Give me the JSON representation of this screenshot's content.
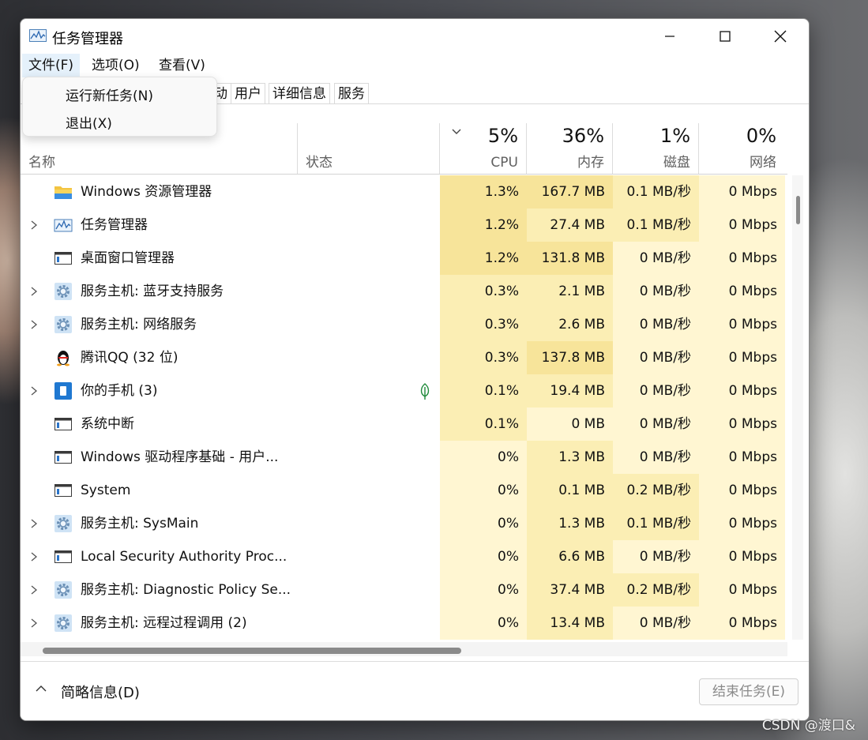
{
  "window": {
    "title": "任务管理器"
  },
  "menu": [
    {
      "label": "文件(F)"
    },
    {
      "label": "选项(O)"
    },
    {
      "label": "查看(V)"
    }
  ],
  "dropdown": [
    {
      "label": "运行新任务(N)"
    },
    {
      "label": "退出(X)"
    }
  ],
  "tabs": [
    {
      "label": "动"
    },
    {
      "label": "用户"
    },
    {
      "label": "详细信息"
    },
    {
      "label": "服务"
    }
  ],
  "columns": {
    "name": "名称",
    "status": "状态",
    "cpu": {
      "pct": "5%",
      "label": "CPU"
    },
    "mem": {
      "pct": "36%",
      "label": "内存"
    },
    "disk": {
      "pct": "1%",
      "label": "磁盘"
    },
    "net": {
      "pct": "0%",
      "label": "网络"
    }
  },
  "processes": [
    {
      "name": "Windows 资源管理器",
      "icon": "folder-icon",
      "expandable": false,
      "eco": false,
      "cpu": "1.3%",
      "mem": "167.7 MB",
      "disk": "0.1 MB/秒",
      "net": "0 Mbps"
    },
    {
      "name": "任务管理器",
      "icon": "task-manager-icon",
      "expandable": true,
      "eco": false,
      "cpu": "1.2%",
      "mem": "27.4 MB",
      "disk": "0.1 MB/秒",
      "net": "0 Mbps"
    },
    {
      "name": "桌面窗口管理器",
      "icon": "window-app-icon",
      "expandable": false,
      "eco": false,
      "cpu": "1.2%",
      "mem": "131.8 MB",
      "disk": "0 MB/秒",
      "net": "0 Mbps"
    },
    {
      "name": "服务主机: 蓝牙支持服务",
      "icon": "gear-icon",
      "expandable": true,
      "eco": false,
      "cpu": "0.3%",
      "mem": "2.1 MB",
      "disk": "0 MB/秒",
      "net": "0 Mbps"
    },
    {
      "name": "服务主机: 网络服务",
      "icon": "gear-icon",
      "expandable": true,
      "eco": false,
      "cpu": "0.3%",
      "mem": "2.6 MB",
      "disk": "0 MB/秒",
      "net": "0 Mbps"
    },
    {
      "name": "腾讯QQ (32 位)",
      "icon": "qq-penguin-icon",
      "expandable": false,
      "eco": false,
      "cpu": "0.3%",
      "mem": "137.8 MB",
      "disk": "0 MB/秒",
      "net": "0 Mbps"
    },
    {
      "name": "你的手机 (3)",
      "icon": "phone-app-icon",
      "expandable": true,
      "eco": true,
      "cpu": "0.1%",
      "mem": "19.4 MB",
      "disk": "0 MB/秒",
      "net": "0 Mbps"
    },
    {
      "name": "系统中断",
      "icon": "window-app-icon",
      "expandable": false,
      "eco": false,
      "cpu": "0.1%",
      "mem": "0 MB",
      "disk": "0 MB/秒",
      "net": "0 Mbps"
    },
    {
      "name": "Windows 驱动程序基础 - 用户...",
      "icon": "window-app-icon",
      "expandable": false,
      "eco": false,
      "cpu": "0%",
      "mem": "1.3 MB",
      "disk": "0 MB/秒",
      "net": "0 Mbps"
    },
    {
      "name": "System",
      "icon": "window-app-icon",
      "expandable": false,
      "eco": false,
      "cpu": "0%",
      "mem": "0.1 MB",
      "disk": "0.2 MB/秒",
      "net": "0 Mbps"
    },
    {
      "name": "服务主机: SysMain",
      "icon": "gear-icon",
      "expandable": true,
      "eco": false,
      "cpu": "0%",
      "mem": "1.3 MB",
      "disk": "0.1 MB/秒",
      "net": "0 Mbps"
    },
    {
      "name": "Local Security Authority Proc...",
      "icon": "window-app-icon",
      "expandable": true,
      "eco": false,
      "cpu": "0%",
      "mem": "6.6 MB",
      "disk": "0 MB/秒",
      "net": "0 Mbps"
    },
    {
      "name": "服务主机: Diagnostic Policy Se...",
      "icon": "gear-icon",
      "expandable": true,
      "eco": false,
      "cpu": "0%",
      "mem": "37.4 MB",
      "disk": "0.2 MB/秒",
      "net": "0 Mbps"
    },
    {
      "name": "服务主机: 远程过程调用 (2)",
      "icon": "gear-icon",
      "expandable": true,
      "eco": false,
      "cpu": "0%",
      "mem": "13.4 MB",
      "disk": "0 MB/秒",
      "net": "0 Mbps"
    }
  ],
  "footer": {
    "fewer_details": "简略信息(D)",
    "end_task": "结束任务(E)"
  },
  "watermark": "CSDN @渡口&",
  "colors": {
    "heat_low": "#fff4c4",
    "heat_mid": "#f9ec a8",
    "heat_high": "#f7e69a"
  }
}
